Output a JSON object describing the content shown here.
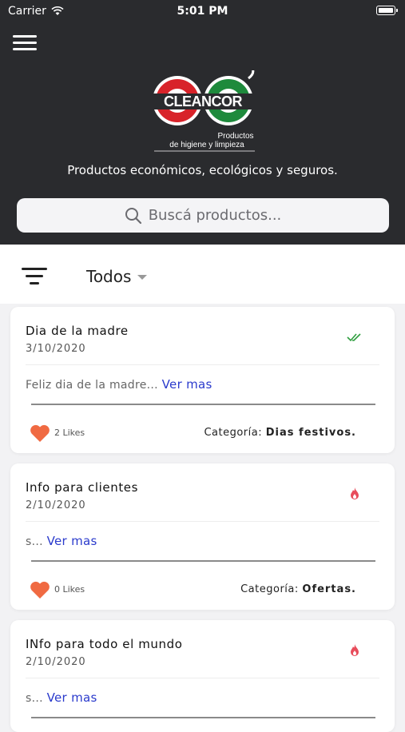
{
  "status_bar": {
    "carrier": "Carrier",
    "time": "5:01 PM"
  },
  "header": {
    "logo": {
      "brand": "CLEANCOR",
      "sub1": "Productos",
      "sub2": "de higiene y limpieza"
    },
    "tagline": "Productos económicos, ecológicos y seguros.",
    "search_placeholder": "Buscá productos..."
  },
  "filter": {
    "selected": "Todos"
  },
  "colors": {
    "header_bg": "#2a2b2e",
    "link": "#2a3acc",
    "heart": "#f06a42",
    "flame": "#e84c5b",
    "check": "#2e9e3e"
  },
  "posts": [
    {
      "title": "Dia de la madre",
      "date": "3/10/2020",
      "status_icon": "double-check-icon",
      "excerpt": "Feliz dia de la madre...",
      "more_label": "Ver mas",
      "likes": "2 Likes",
      "category_label": "Categoría:",
      "category": "Dias festivos."
    },
    {
      "title": "Info para clientes",
      "date": "2/10/2020",
      "status_icon": "flame-icon",
      "excerpt": "s...",
      "more_label": "Ver mas",
      "likes": "0 Likes",
      "category_label": "Categoría:",
      "category": "Ofertas."
    },
    {
      "title": "INfo para todo el mundo",
      "date": "2/10/2020",
      "status_icon": "flame-icon",
      "excerpt": "s...",
      "more_label": "Ver mas"
    }
  ]
}
